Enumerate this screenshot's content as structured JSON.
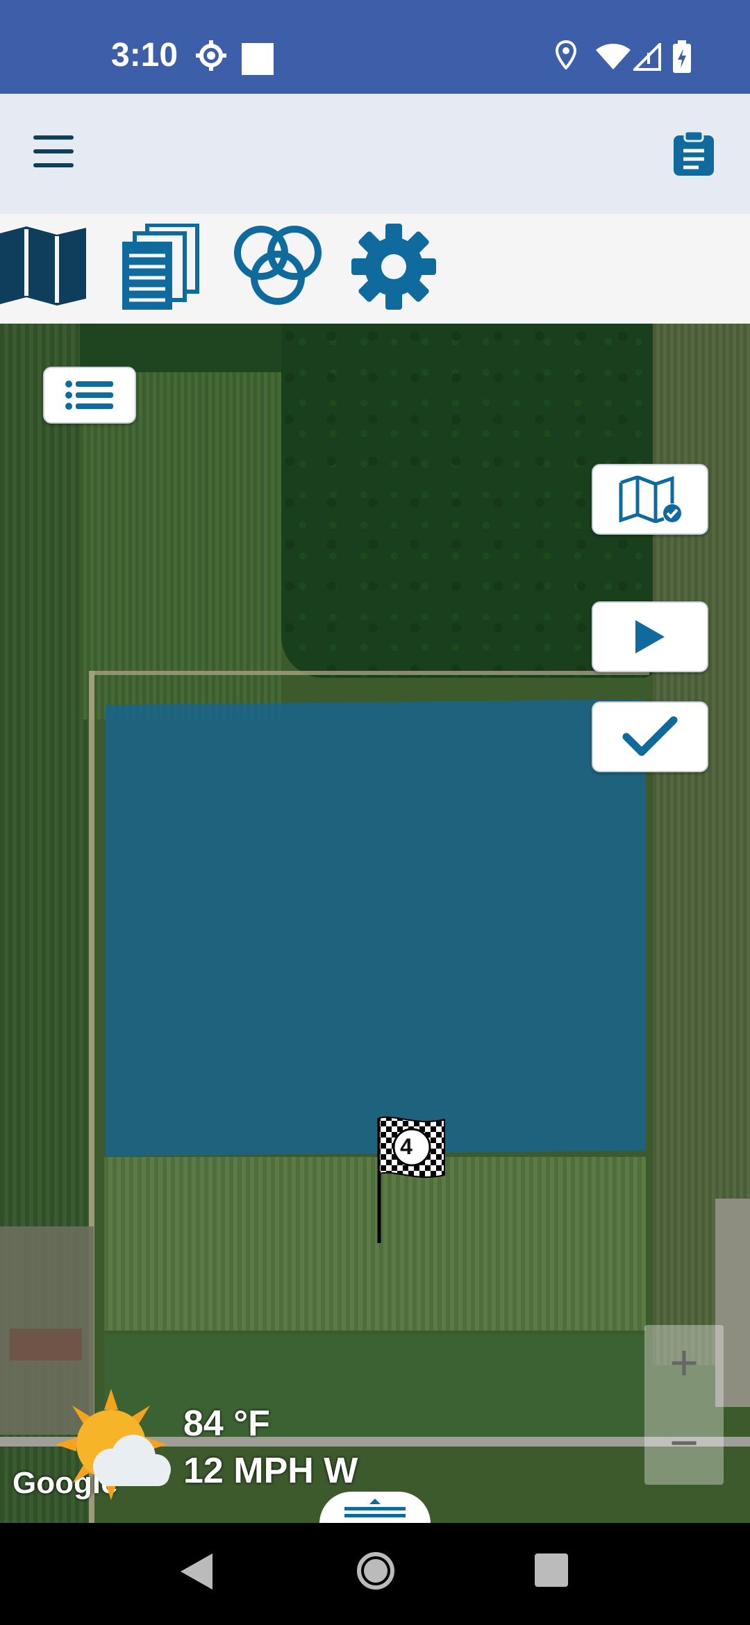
{
  "status_bar": {
    "time": "3:10",
    "icons": [
      "gear-settings-icon",
      "square-notification-icon",
      "location-icon",
      "wifi-icon",
      "signal-icon",
      "battery-charging-icon"
    ],
    "background": "#3d5ea8"
  },
  "app_bar": {
    "menu_icon": "hamburger-menu-icon",
    "clipboard_icon": "clipboard-icon",
    "accent": "#0f6a9e"
  },
  "toolbar": {
    "tools": [
      "map-icon",
      "documents-icon",
      "rings-icon",
      "settings-gear-icon"
    ]
  },
  "map": {
    "attribution": "Google",
    "flag_label": "4",
    "boundary_color": "#1a648c",
    "buttons": [
      "list-icon",
      "map-checked-icon",
      "play-icon",
      "checkmark-icon"
    ],
    "zoom_in": "+",
    "zoom_out": "−"
  },
  "weather": {
    "icon": "partly-sunny-icon",
    "temperature": "84 °F",
    "wind": "12 MPH W"
  },
  "nav_bar": {
    "icons": [
      "back-icon",
      "home-icon",
      "recents-icon"
    ]
  }
}
